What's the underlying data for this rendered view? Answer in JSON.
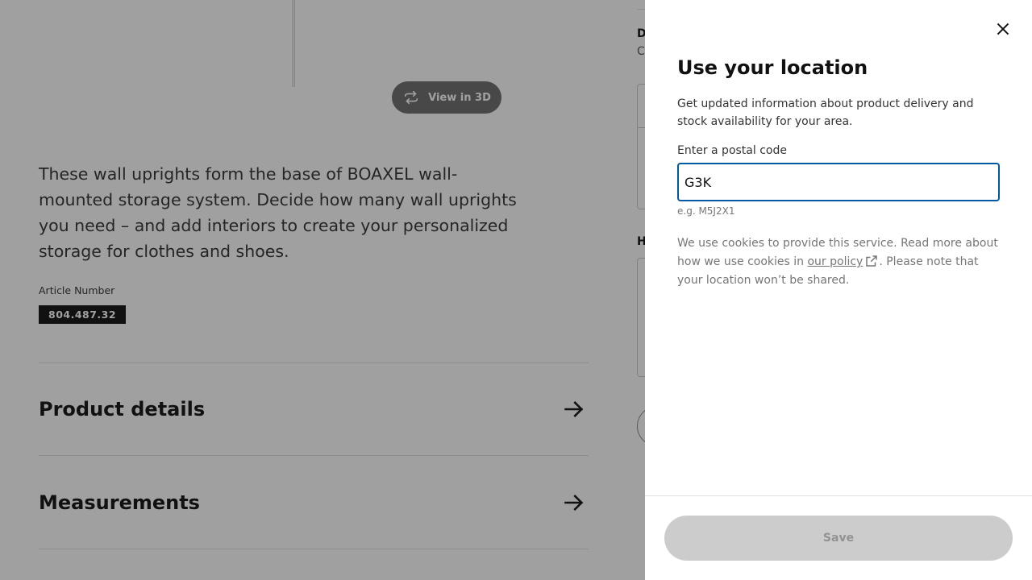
{
  "product": {
    "view3d_label": "View in 3D",
    "description": "These wall uprights form the base of BOAXEL wall-mounted storage system. Decide how many wall uprights you need – and add interiors to create your personalized storage for clothes and shoes.",
    "article_label": "Article Number",
    "article_number": "804.487.32",
    "sections": [
      {
        "title": "Product details"
      },
      {
        "title": "Measurements"
      }
    ],
    "right_col": {
      "d_text": "D",
      "c_text": "C",
      "h_text": "H"
    }
  },
  "modal": {
    "title": "Use your location",
    "description": "Get updated information about product delivery and stock availability for your area.",
    "postal_label": "Enter a postal code",
    "postal_value": "G3K",
    "postal_hint": "e.g. M5J2X1",
    "cookie_text_before": "We use cookies to provide this service. Read more about how we use cookies in ",
    "cookie_link": "our policy",
    "cookie_text_after": ". Please note that your location won’t be shared.",
    "save_label": "Save"
  },
  "icons": {
    "close": "close-icon",
    "arrow": "arrow-right-icon",
    "rotate": "rotate-3d-icon",
    "external": "external-link-icon"
  }
}
